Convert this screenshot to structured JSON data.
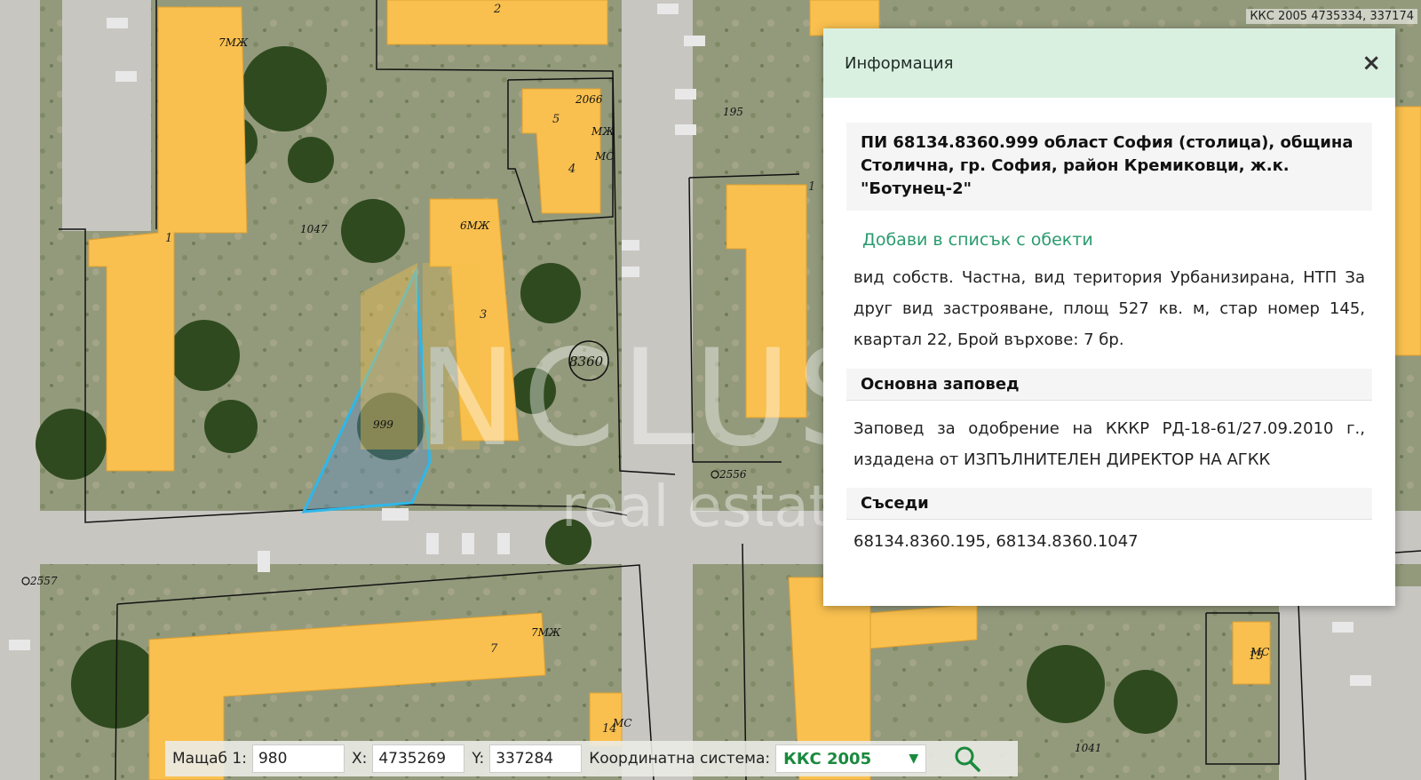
{
  "coordinate_readout": "ККС 2005 4735334, 337174",
  "map": {
    "parcel_numbers": [
      "1047",
      "999",
      "195",
      "2066",
      "2556",
      "2557",
      "1041"
    ],
    "block_labels": [
      "1",
      "2",
      "3",
      "4",
      "5",
      "7",
      "14",
      "15",
      "1"
    ],
    "block_codes": [
      "7МЖ",
      "6МЖ",
      "МЖ",
      "МС",
      "7МЖ",
      "МС",
      "МС"
    ],
    "quarter_label": "8360",
    "watermark_brand": "NCLUSIVE",
    "watermark_sub": "real estate",
    "colors": {
      "building": "#f9c04f",
      "parcel_highlight": "#2db8ea",
      "boundary": "#111111"
    }
  },
  "info_panel": {
    "title": "Информация",
    "close_label": "×",
    "parcel_title": "ПИ 68134.8360.999 област София (столица), община Столична, гр. София, район Кремиковци, ж.к. \"Ботунец-2\"",
    "add_link": "Добави в списък с обекти",
    "details": "вид собств. Частна, вид територия Урбанизирана, НТП За друг вид застрояване, площ 527 кв. м, стар номер 145, квартал 22, Брой върхове: 7 бр.",
    "order_heading": "Основна заповед",
    "order_text": "Заповед за одобрение на КККР РД-18-61/27.09.2010 г., издадена от ИЗПЪЛНИТЕЛЕН ДИРЕКТОР НА АГКК",
    "neighbours_heading": "Съседи",
    "neighbours_text": "68134.8360.195, 68134.8360.1047",
    "colors": {
      "header_bg": "#d9f0e1",
      "link": "#2a9b6e"
    }
  },
  "toolbar": {
    "scale_label": "Мащаб 1:",
    "scale_value": "980",
    "x_label": "X:",
    "x_value": "4735269",
    "y_label": "Y:",
    "y_value": "337284",
    "crs_label": "Координатна система:",
    "crs_value": "ККС 2005",
    "colors": {
      "crs": "#1a8a3e"
    }
  }
}
